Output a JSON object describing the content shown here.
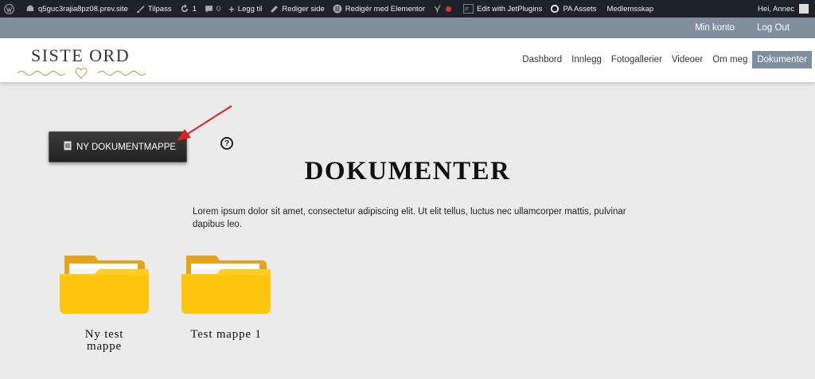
{
  "adminbar": {
    "site": "q5guc3rajia8pz08.prev.site",
    "customize": "Tilpass",
    "updates_count": "1",
    "comments_count": "0",
    "new": "Legg til",
    "edit_page": "Rediger side",
    "elementor": "Redigér med Elementor",
    "jetplugins": "Edit with JetPlugins",
    "pa_assets": "PA Assets",
    "membership": "Medlemsskap",
    "greeting": "Hei, Annec"
  },
  "account": {
    "my_account": "Min konto",
    "logout": "Log Out"
  },
  "logo": {
    "text": "SISTE ORD"
  },
  "nav": [
    {
      "label": "Dashbord"
    },
    {
      "label": "Innlegg"
    },
    {
      "label": "Fotogallerier"
    },
    {
      "label": "Videoer"
    },
    {
      "label": "Om meg"
    },
    {
      "label": "Dokumenter"
    }
  ],
  "main": {
    "new_folder_button": "NY DOKUMENTMAPPE",
    "help": "?",
    "title": "DOKUMENTER",
    "intro": "Lorem ipsum dolor sit amet, consectetur adipiscing elit. Ut elit tellus, luctus nec ullamcorper mattis, pulvinar dapibus leo.",
    "folders": [
      {
        "label": "Ny test mappe"
      },
      {
        "label": "Test mappe 1"
      }
    ]
  },
  "colors": {
    "adminbar": "#1d2327",
    "accent": "#7f8f9e",
    "folder": "#ffc107",
    "arrow": "#e02020"
  },
  "icons": [
    "wordpress-icon",
    "site-icon",
    "brush-icon",
    "refresh-icon",
    "comment-icon",
    "plus-icon",
    "pencil-icon",
    "elementor-icon",
    "yoast-icon",
    "record-icon",
    "jetplugins-icon",
    "pa-assets-icon",
    "document-icon",
    "help-icon",
    "folder-icon",
    "arrow-icon"
  ]
}
